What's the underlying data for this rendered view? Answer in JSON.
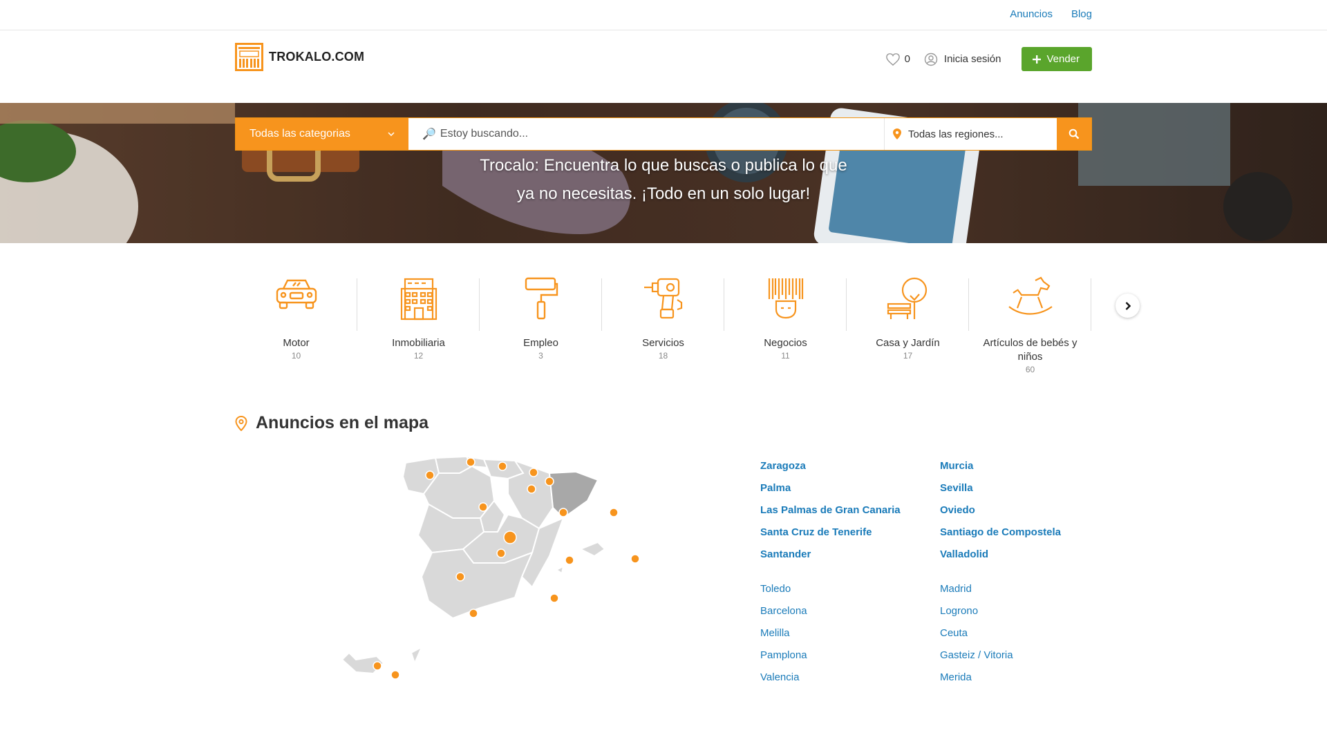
{
  "topbar": {
    "links": [
      "Anuncios",
      "Blog"
    ]
  },
  "header": {
    "logo_text": "TROKALO.COM",
    "favorites_count": "0",
    "login_label": "Inicia sesión",
    "sell_label": "Vender"
  },
  "search": {
    "category": "Todas las categorias",
    "placeholder": "Estoy buscando...",
    "region": "Todas las regiones..."
  },
  "hero": {
    "line1": "Trocalo: Encuentra lo que buscas o publica lo que",
    "line2": "ya no necesitas. ¡Todo en un solo lugar!"
  },
  "categories": [
    {
      "label": "Motor",
      "count": "10",
      "icon": "car-icon"
    },
    {
      "label": "Inmobiliaria",
      "count": "12",
      "icon": "building-icon"
    },
    {
      "label": "Empleo",
      "count": "3",
      "icon": "paint-roller-icon"
    },
    {
      "label": "Servicios",
      "count": "18",
      "icon": "drill-icon"
    },
    {
      "label": "Negocios",
      "count": "11",
      "icon": "barcode-icon"
    },
    {
      "label": "Casa y Jardín",
      "count": "17",
      "icon": "bench-tree-icon"
    },
    {
      "label": "Artículos de bebés y niños",
      "count": "60",
      "icon": "rocking-horse-icon"
    }
  ],
  "map": {
    "title": "Anuncios en el mapa"
  },
  "cities": {
    "left_bold": [
      "Zaragoza",
      "Palma",
      "Las Palmas de Gran Canaria",
      "Santa Cruz de Tenerife",
      "Santander"
    ],
    "right_bold": [
      "Murcia",
      "Sevilla",
      "Oviedo",
      "Santiago de Compostela",
      "Valladolid"
    ],
    "left": [
      "Toledo",
      "Barcelona",
      "Melilla",
      "Pamplona",
      "Valencia"
    ],
    "right": [
      "Madrid",
      "Logrono",
      "Ceuta",
      "Gasteiz / Vitoria",
      "Merida"
    ]
  },
  "colors": {
    "accent": "#f7941d",
    "link": "#1a7bb9",
    "sell": "#5aa52c"
  }
}
